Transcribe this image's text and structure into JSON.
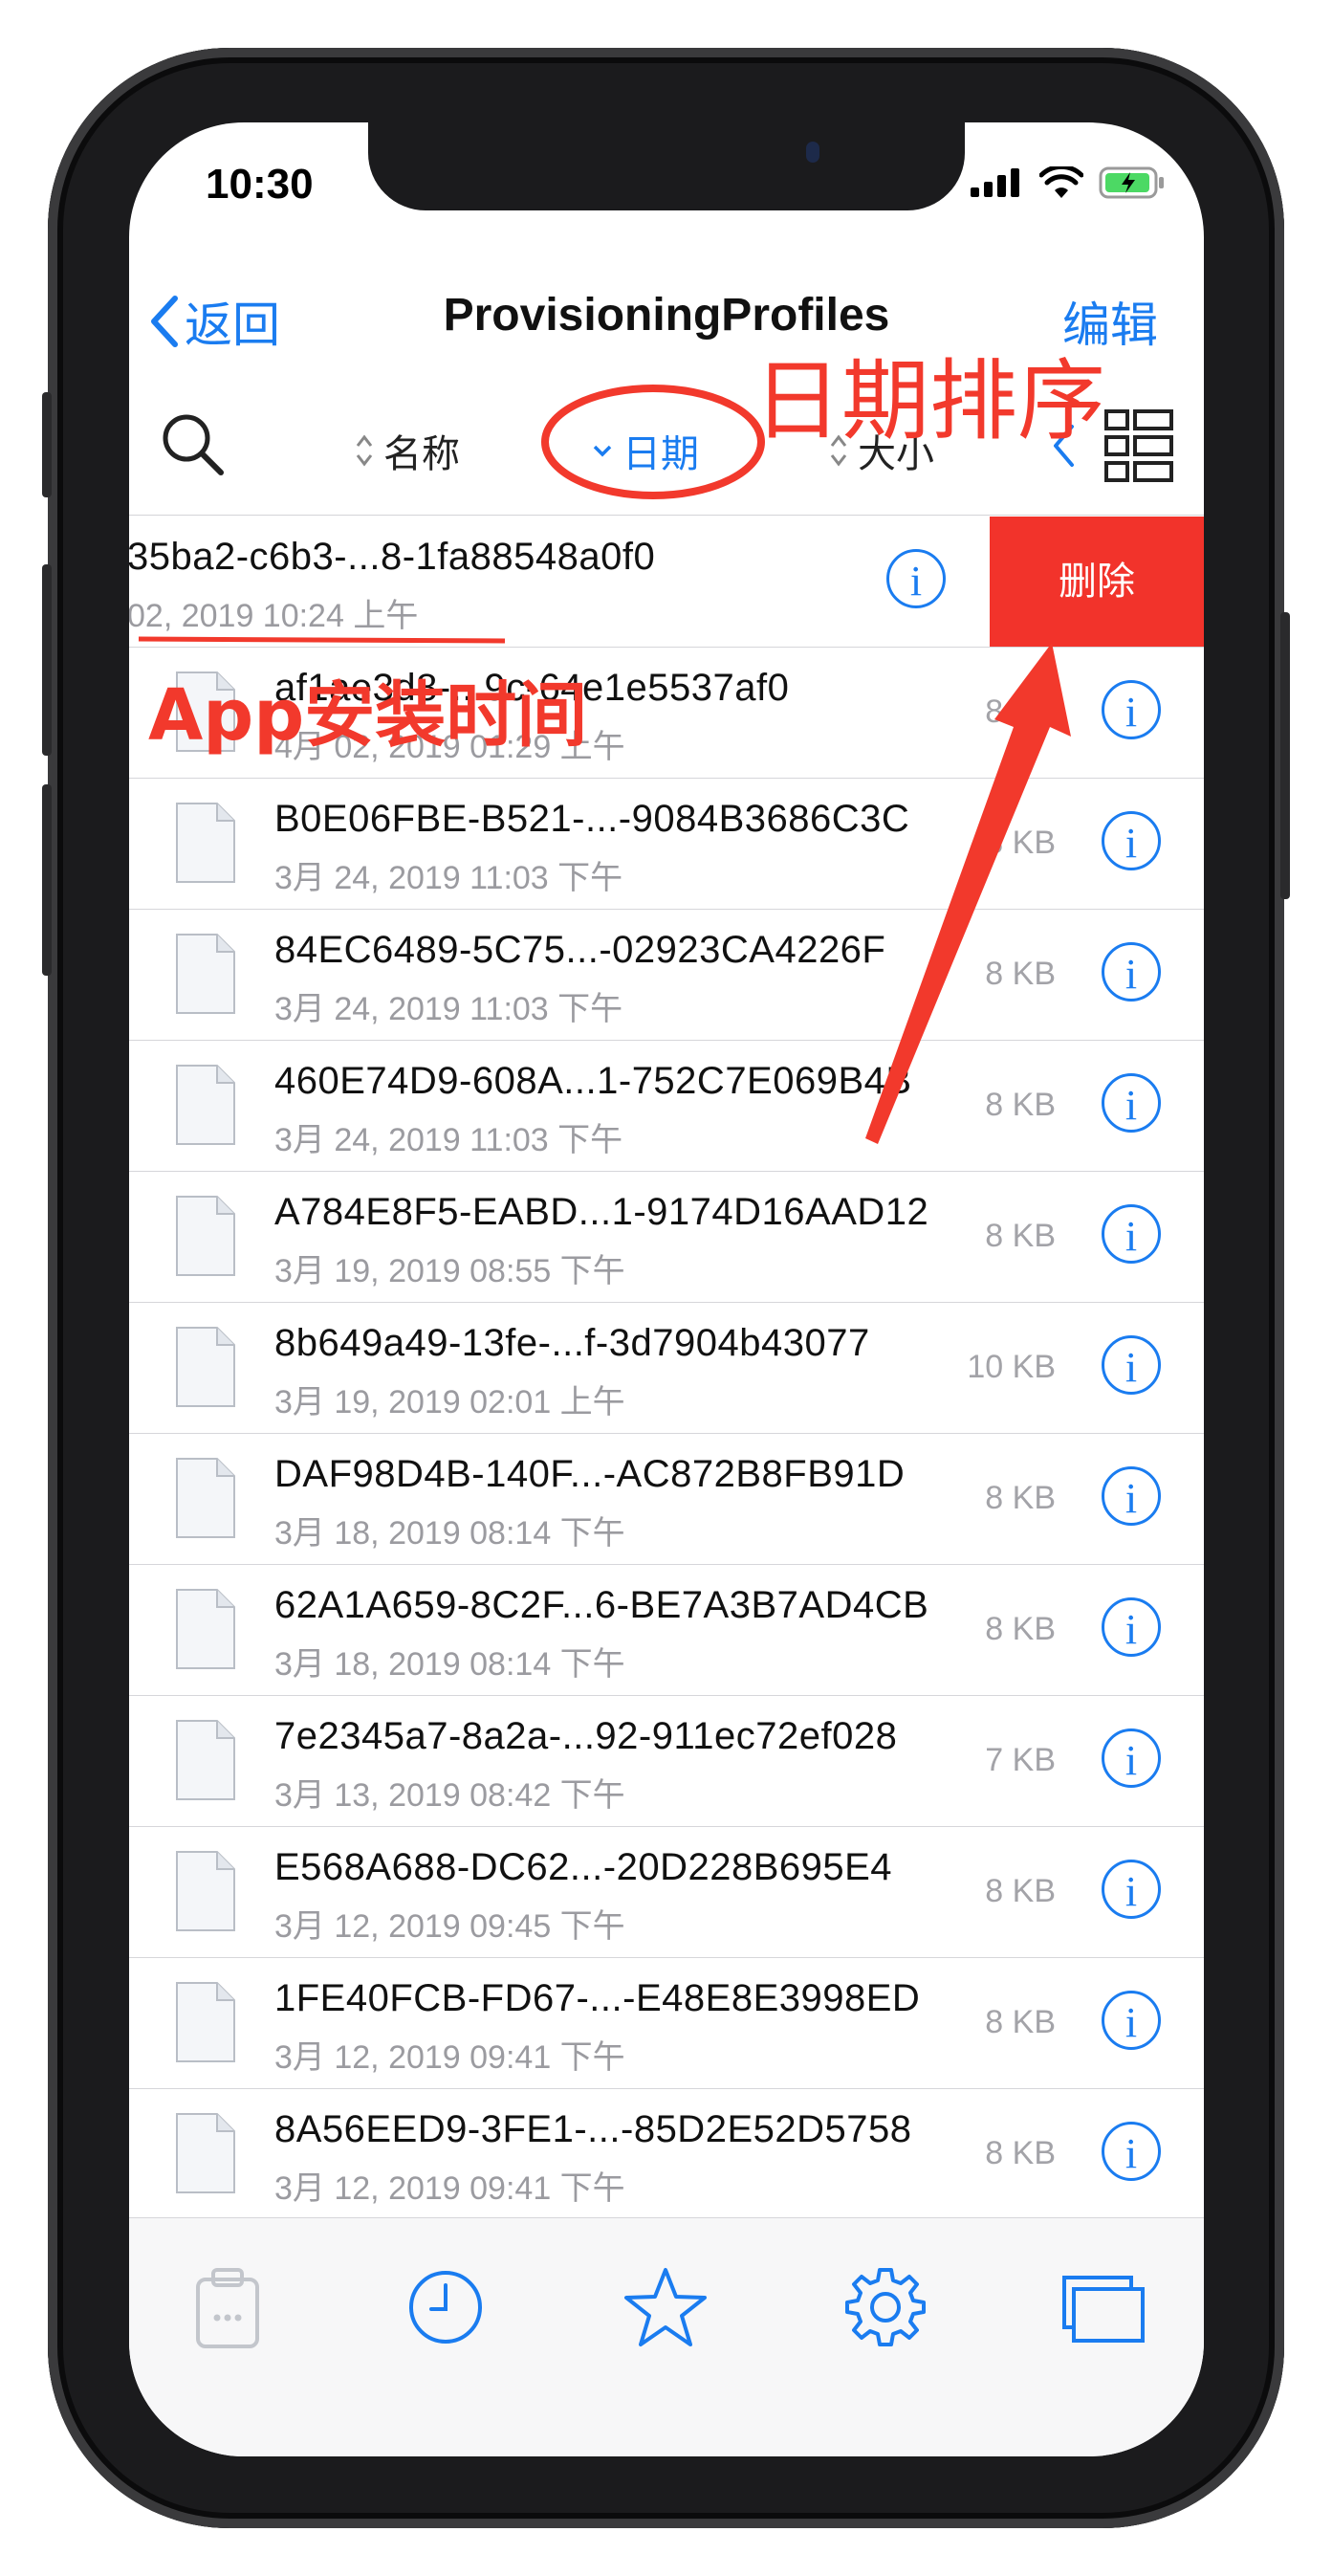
{
  "status_bar": {
    "time": "10:30"
  },
  "nav": {
    "back_label": "返回",
    "title": "ProvisioningProfiles",
    "edit_label": "编辑"
  },
  "sort": {
    "name_label": "名称",
    "date_label": "日期",
    "size_label": "大小"
  },
  "files": [
    {
      "name": "35ba2-c6b3-...8-1fa88548a0f0",
      "date": "02, 2019 10:24 上午",
      "size": ""
    },
    {
      "name": "af1ae3d8-...9c-64e1e5537af0",
      "date": "4月 02, 2019 01:29 上午",
      "size": "8 KB"
    },
    {
      "name": "B0E06FBE-B521-...-9084B3686C3C",
      "date": "3月 24, 2019 11:03 下午",
      "size": "8 KB"
    },
    {
      "name": "84EC6489-5C75...-02923CA4226F",
      "date": "3月 24, 2019 11:03 下午",
      "size": "8 KB"
    },
    {
      "name": "460E74D9-608A...1-752C7E069B4B",
      "date": "3月 24, 2019 11:03 下午",
      "size": "8 KB"
    },
    {
      "name": "A784E8F5-EABD...1-9174D16AAD12",
      "date": "3月 19, 2019 08:55 下午",
      "size": "8 KB"
    },
    {
      "name": "8b649a49-13fe-...f-3d7904b43077",
      "date": "3月 19, 2019 02:01 上午",
      "size": "10 KB"
    },
    {
      "name": "DAF98D4B-140F...-AC872B8FB91D",
      "date": "3月 18, 2019 08:14 下午",
      "size": "8 KB"
    },
    {
      "name": "62A1A659-8C2F...6-BE7A3B7AD4CB",
      "date": "3月 18, 2019 08:14 下午",
      "size": "8 KB"
    },
    {
      "name": "7e2345a7-8a2a-...92-911ec72ef028",
      "date": "3月 13, 2019 08:42 下午",
      "size": "7 KB"
    },
    {
      "name": "E568A688-DC62...-20D228B695E4",
      "date": "3月 12, 2019 09:45 下午",
      "size": "8 KB"
    },
    {
      "name": "1FE40FCB-FD67-...-E48E8E3998ED",
      "date": "3月 12, 2019 09:41 下午",
      "size": "8 KB"
    },
    {
      "name": "8A56EED9-3FE1-...-85D2E52D5758",
      "date": "3月 12, 2019 09:41 下午",
      "size": "8 KB"
    }
  ],
  "swipe_action": {
    "delete_label": "删除"
  },
  "annotations": {
    "date_sort": "日期排序",
    "app_install_time": "App安装时间"
  },
  "tabbar": {
    "icons": [
      "clipboard-icon",
      "clock-icon",
      "star-icon",
      "gear-icon",
      "windows-icon"
    ]
  },
  "colors": {
    "accent": "#1a7cf0",
    "delete": "#f2332b",
    "annotation": "#f2392c"
  }
}
